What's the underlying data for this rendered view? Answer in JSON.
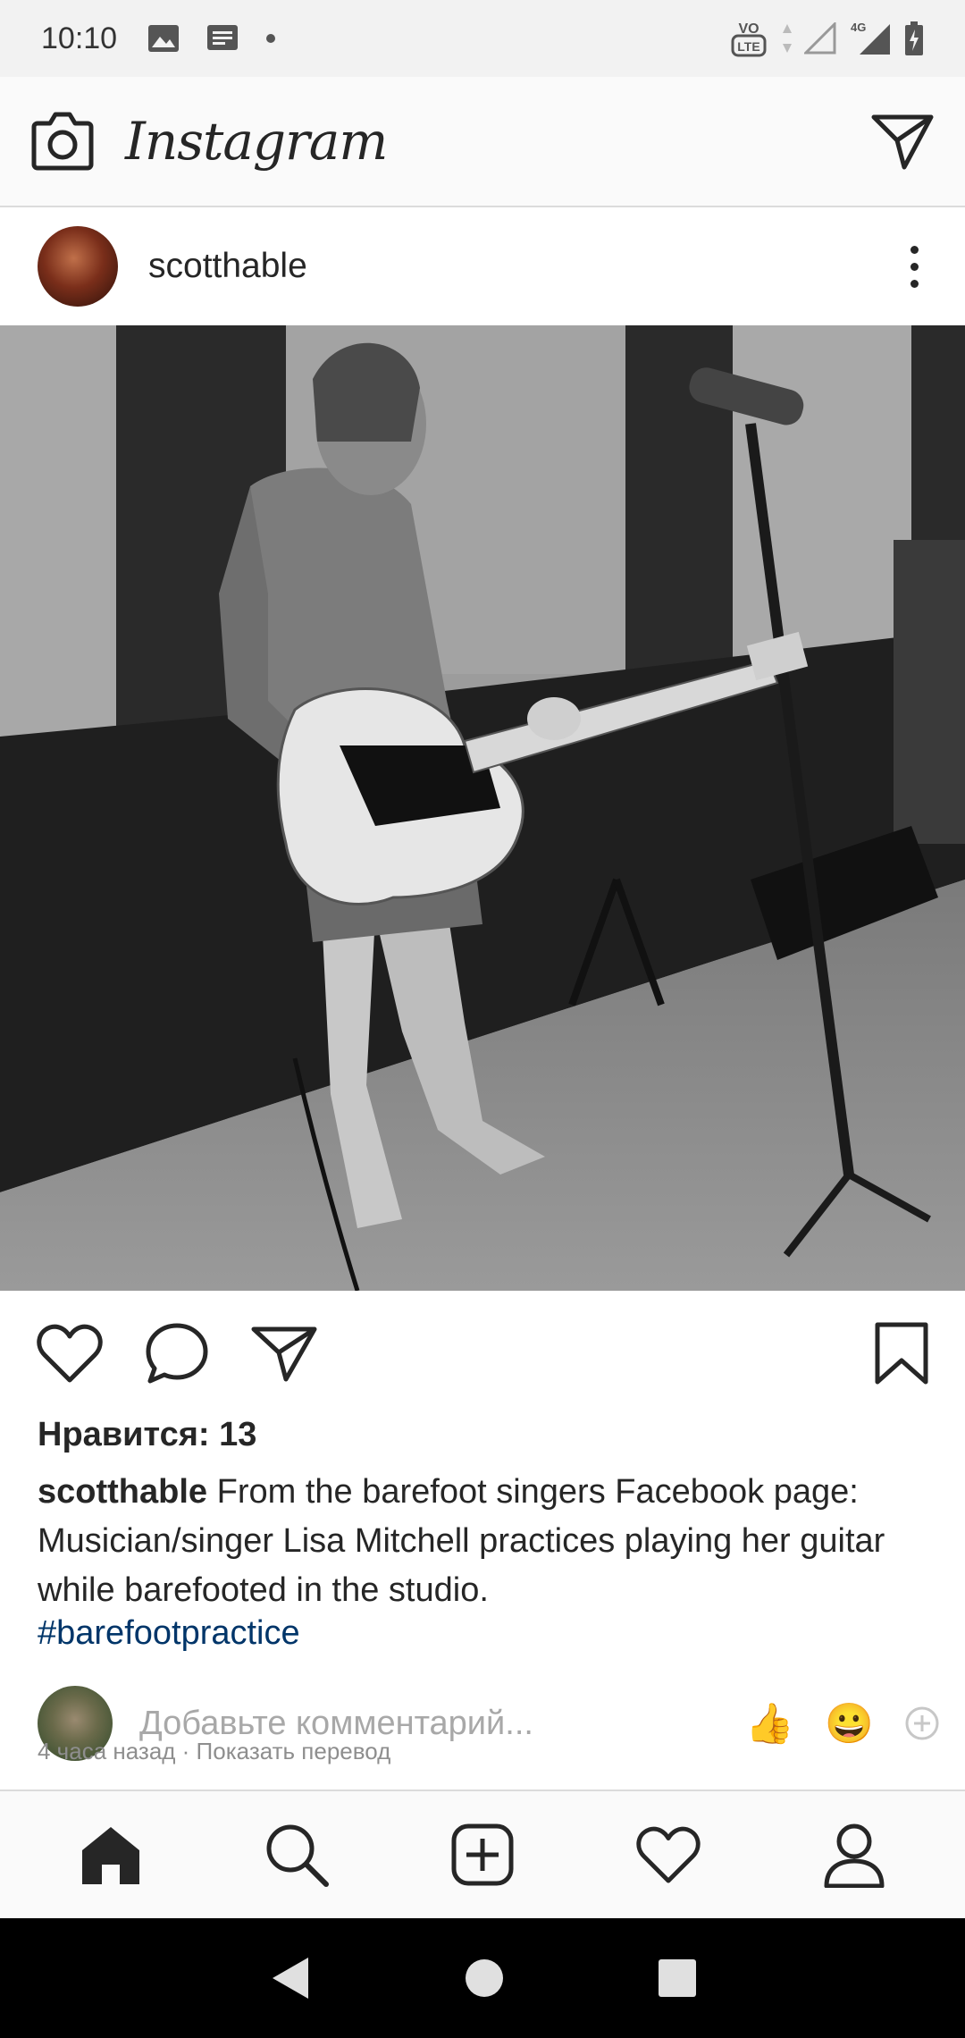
{
  "status_bar": {
    "time": "10:10",
    "left_icons": [
      "image-icon",
      "message-icon",
      "dot-icon"
    ],
    "right_icons": [
      "volte-icon",
      "signal-empty-icon",
      "signal-4g-icon",
      "battery-icon"
    ],
    "network_label": "4G",
    "volte_label": "Vo LTE"
  },
  "header": {
    "brand": "Instagram",
    "left_icon": "camera-icon",
    "right_icon": "direct-message-icon"
  },
  "post": {
    "username": "scotthable",
    "more_icon": "more-vertical-icon",
    "photo_alt": "barefoot-guitarist-photo",
    "likes_text": "Нравится: 13",
    "caption_user": "scotthable",
    "caption_text": " From the barefoot singers Facebook page: Musician/singer Lisa Mitchell practices playing her guitar while barefooted in the studio.",
    "hashtag": "#barefootpractice",
    "comment_placeholder": "Добавьте комментарий...",
    "emoji_1": "👍",
    "emoji_2": "😀",
    "timestamp": "4 часа назад · Показать перевод"
  },
  "actions": [
    "like-icon",
    "comment-icon",
    "share-icon",
    "bookmark-icon"
  ],
  "bottom_nav": [
    "home-icon",
    "search-icon",
    "new-post-icon",
    "activity-icon",
    "profile-icon"
  ],
  "system_nav": [
    "back-icon",
    "home-circle-icon",
    "recents-icon"
  ]
}
